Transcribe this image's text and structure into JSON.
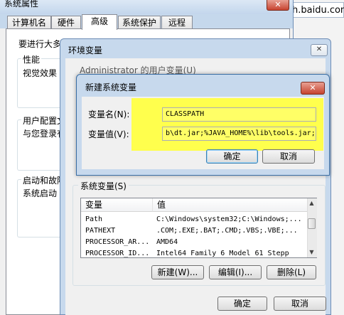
{
  "browser": {
    "url_fragment": "h.baidu.com/",
    "tab_fragment": ""
  },
  "system_properties": {
    "title": "系统属性",
    "tabs": [
      {
        "label": "计算机名",
        "selected": false
      },
      {
        "label": "硬件",
        "selected": false
      },
      {
        "label": "高级",
        "selected": true
      },
      {
        "label": "系统保护",
        "selected": false
      },
      {
        "label": "远程",
        "selected": false
      }
    ],
    "intro_text": "要进行大多",
    "performance_heading": "性能",
    "performance_text": "视觉效果",
    "profiles_heading": "用户配置文",
    "profiles_text": "与您登录有",
    "startup_heading": "启动和故障",
    "startup_text": "系统启动",
    "close_glyph": "✕"
  },
  "env_dialog": {
    "title": "环境变量",
    "close_glyph": "✕",
    "user_vars_label": "Administrator 的用户变量(U)",
    "system_vars_label": "系统变量(S)",
    "table_headers": {
      "variable": "变量",
      "value": "值"
    },
    "rows": [
      {
        "variable": "Path",
        "value": "C:\\Windows\\system32;C:\\Windows;..."
      },
      {
        "variable": "PATHEXT",
        "value": ".COM;.EXE;.BAT;.CMD;.VBS;.VBE;..."
      },
      {
        "variable": "PROCESSOR_AR...",
        "value": "AMD64"
      },
      {
        "variable": "PROCESSOR_ID...",
        "value": "Intel64 Family 6 Model 61 Stepp"
      }
    ],
    "buttons": {
      "new": "新建(W)...",
      "edit": "编辑(I)...",
      "delete": "删除(L)",
      "ok": "确定",
      "cancel": "取消"
    }
  },
  "new_var_dialog": {
    "title": "新建系统变量",
    "close_glyph": "✕",
    "name_label": "变量名(N):",
    "value_label": "变量值(V):",
    "name_value": "CLASSPATH",
    "value_value": "b\\dt.jar;%JAVA_HOME%\\lib\\tools.jar;",
    "buttons": {
      "ok": "确定",
      "cancel": "取消"
    }
  }
}
